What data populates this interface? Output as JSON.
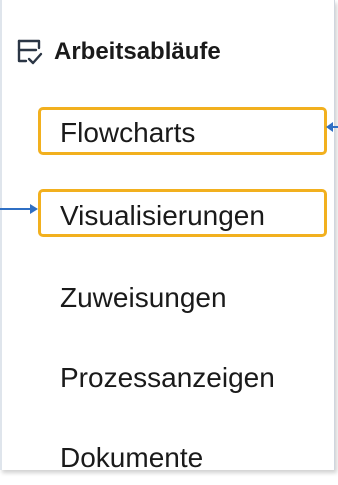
{
  "sidebar": {
    "header": {
      "icon": "workflow-list-check-icon",
      "title": "Arbeitsabläufe"
    },
    "items": [
      {
        "label": "Flowcharts",
        "highlighted": true
      },
      {
        "label": "Visualisierungen",
        "highlighted": true
      },
      {
        "label": "Zuweisungen",
        "highlighted": false
      },
      {
        "label": "Prozessanzeigen",
        "highlighted": false
      },
      {
        "label": "Dokumente",
        "highlighted": false
      }
    ]
  },
  "annotations": {
    "highlight_color": "#f2b01e",
    "arrow_color": "#2f6fc4"
  }
}
